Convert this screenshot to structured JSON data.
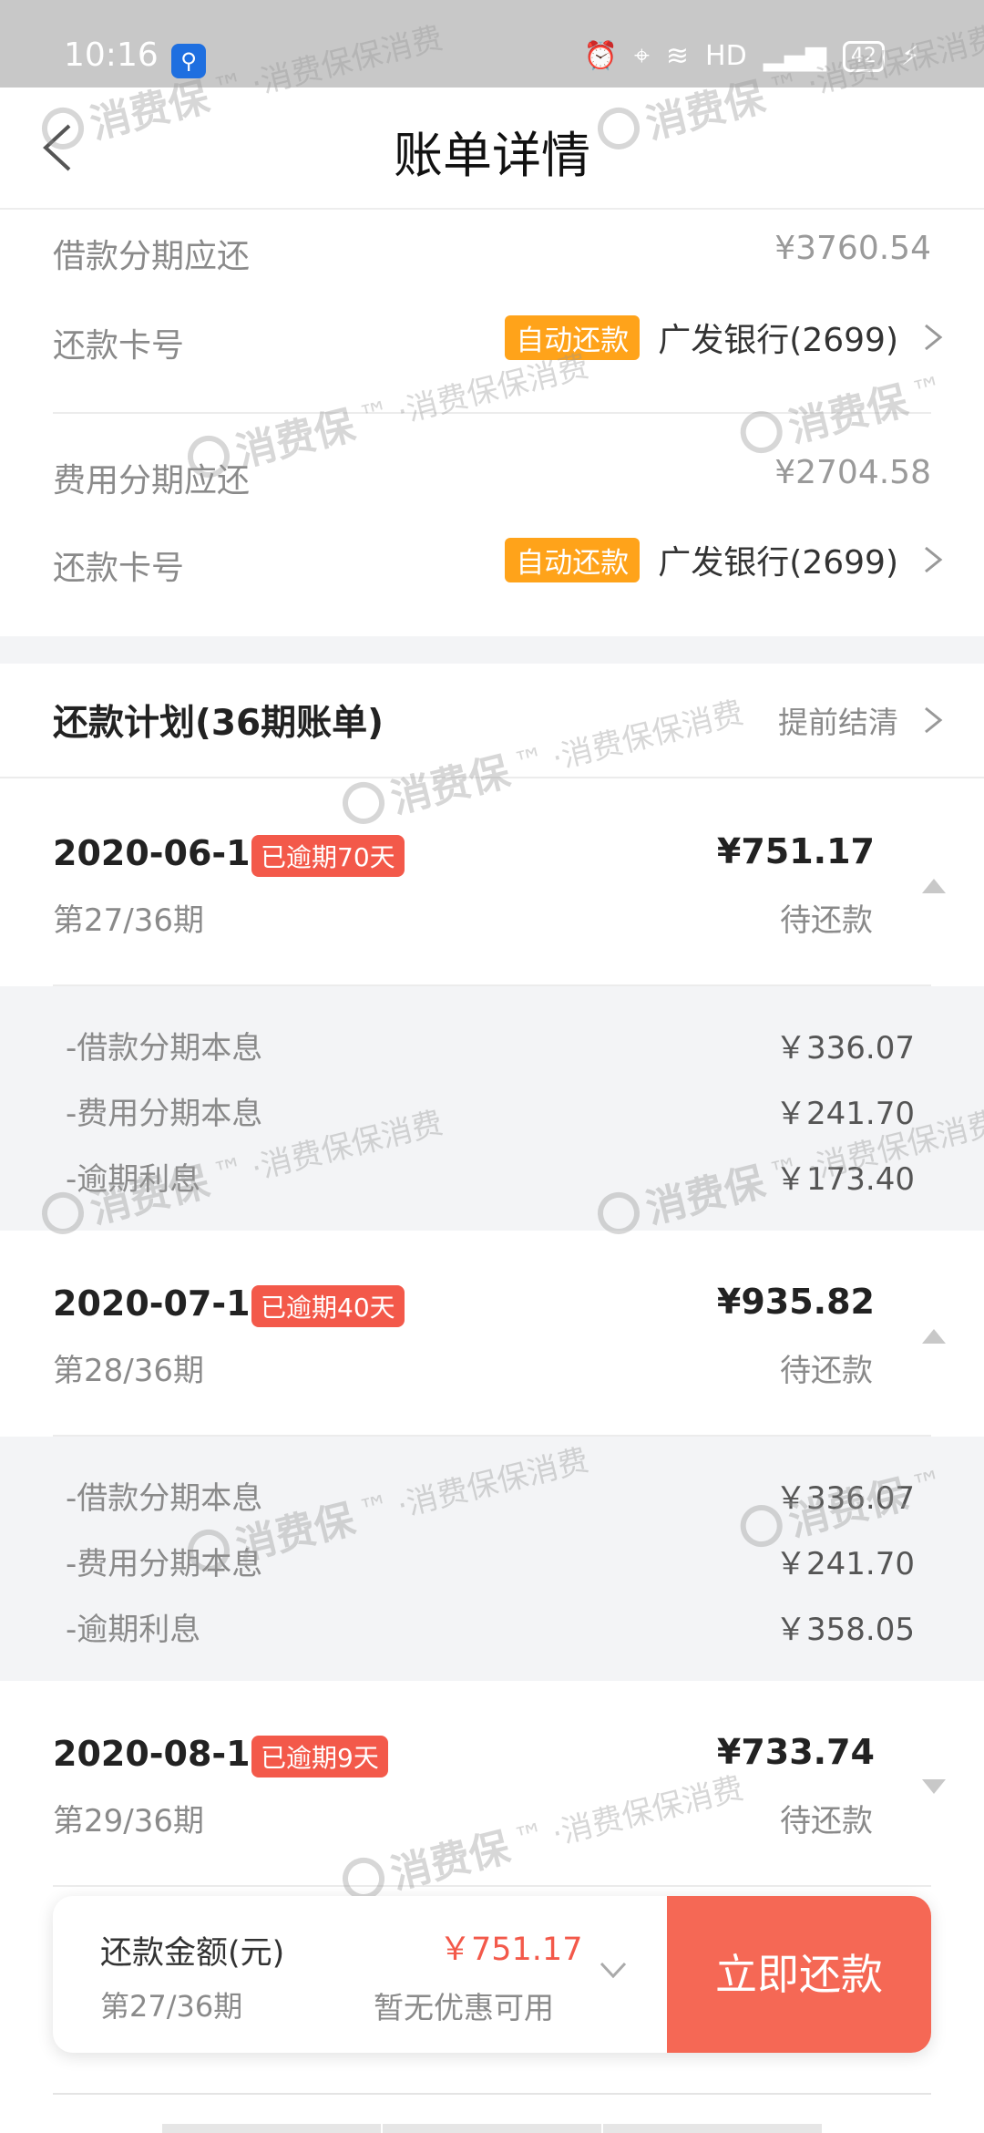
{
  "status_bar": {
    "time": "10:16",
    "network": "HD",
    "battery": "42"
  },
  "nav": {
    "title": "账单详情"
  },
  "loan": {
    "label": "借款分期应还",
    "amount": "¥3760.54",
    "card_label": "还款卡号",
    "auto_badge": "自动还款",
    "bank": "广发银行(2699)"
  },
  "fee": {
    "label": "费用分期应还",
    "amount": "¥2704.58",
    "card_label": "还款卡号",
    "auto_badge": "自动还款",
    "bank": "广发银行(2699)"
  },
  "plan": {
    "title": "还款计划(36期账单)",
    "early_settle": "提前结清"
  },
  "installments": [
    {
      "date": "2020-06-10",
      "overdue": "已逾期70天",
      "period": "第27/36期",
      "amount": "¥751.17",
      "status": "待还款",
      "expanded": true,
      "details": [
        {
          "label": "-借款分期本息",
          "value": "￥336.07"
        },
        {
          "label": "-费用分期本息",
          "value": "￥241.70"
        },
        {
          "label": "-逾期利息",
          "value": "￥173.40"
        }
      ]
    },
    {
      "date": "2020-07-10",
      "overdue": "已逾期40天",
      "period": "第28/36期",
      "amount": "¥935.82",
      "status": "待还款",
      "expanded": true,
      "details": [
        {
          "label": "-借款分期本息",
          "value": "￥336.07"
        },
        {
          "label": "-费用分期本息",
          "value": "￥241.70"
        },
        {
          "label": "-逾期利息",
          "value": "￥358.05"
        }
      ]
    },
    {
      "date": "2020-08-10",
      "overdue": "已逾期9天",
      "period": "第29/36期",
      "amount": "¥733.74",
      "status": "待还款",
      "expanded": false
    }
  ],
  "bottom": {
    "label": "还款金额(元)",
    "period": "第27/36期",
    "amount": "￥751.17",
    "discount": "暂无优惠可用",
    "pay_button": "立即还款"
  },
  "watermark": {
    "logo_text": "消费保",
    "tm": "™",
    "tagline": "·消费保保消费"
  },
  "colors": {
    "accent": "#f56855",
    "overdue": "#f3594a",
    "auto_badge": "#ffa31a",
    "panel": "#f3f4f6"
  }
}
